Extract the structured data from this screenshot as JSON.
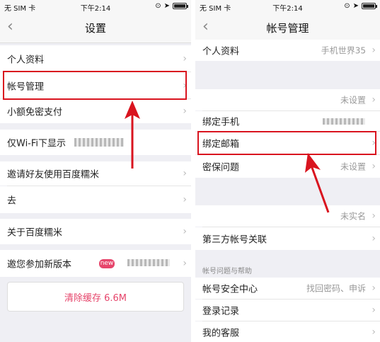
{
  "status": {
    "carrier": "无 SIM 卡",
    "time": "下午2:14"
  },
  "left": {
    "title": "设置",
    "items": [
      {
        "label": "个人资料"
      },
      {
        "label": "帐号管理"
      },
      {
        "label": "小额免密支付"
      },
      {
        "label": "仅Wi-Fi下显示"
      },
      {
        "label": "邀请好友使用百度糯米"
      },
      {
        "label": "去"
      },
      {
        "label": "关于百度糯米"
      },
      {
        "label": "邀您参加新版本"
      }
    ],
    "new_badge": "new",
    "clear_cache": "清除缓存 6.6M"
  },
  "right": {
    "title": "帐号管理",
    "rows": [
      {
        "label": "个人资料",
        "value": "手机世界35"
      },
      {
        "label": "",
        "value": "未设置"
      },
      {
        "label": "绑定手机",
        "value": ""
      },
      {
        "label": "绑定邮箱",
        "value": ""
      },
      {
        "label": "密保问题",
        "value": "未设置"
      },
      {
        "label": "",
        "value": "未实名"
      },
      {
        "label": "第三方帐号关联",
        "value": ""
      },
      {
        "label": "帐号安全中心",
        "value": "找回密码、申诉"
      },
      {
        "label": "登录记录",
        "value": ""
      },
      {
        "label": "我的客服",
        "value": ""
      }
    ],
    "section_help": "帐号问题与帮助"
  },
  "highlight_color": "#d9141f"
}
